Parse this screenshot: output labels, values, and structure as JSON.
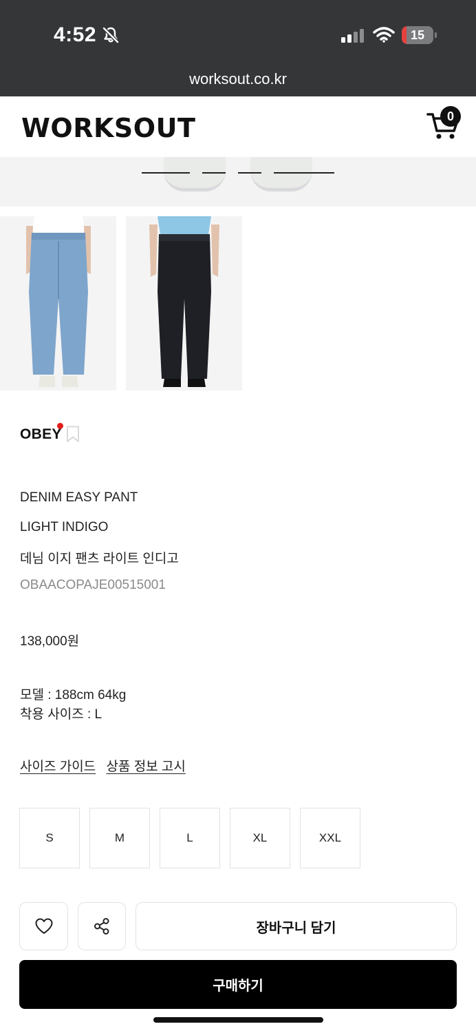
{
  "status_bar": {
    "time": "4:52",
    "battery": "15",
    "battery_level": 0.15,
    "icons": [
      "bell-slash-icon",
      "signal-icon",
      "wifi-icon",
      "battery-icon"
    ]
  },
  "browser": {
    "url": "worksout.co.kr"
  },
  "header": {
    "logo": "WORKSOUT",
    "cart_count": "0",
    "cart_icon": "cart-icon"
  },
  "product": {
    "brand": "OBEY",
    "name_line1": "DENIM EASY PANT",
    "name_line2": "LIGHT INDIGO",
    "name_korean": "데님 이지 팬츠 라이트 인디고",
    "sku": "OBAACOPAJE00515001",
    "price": "138,000원",
    "model_info": "모델 : 188cm  64kg",
    "fit_size": "착용 사이즈 : L"
  },
  "links": {
    "size_guide": "사이즈 가이드",
    "product_notice": "상품 정보 고시"
  },
  "sizes": [
    "S",
    "M",
    "L",
    "XL",
    "XXL"
  ],
  "actions": {
    "add_to_cart": "장바구니 담기",
    "buy_now": "구매하기",
    "wishlist_icon": "heart-icon",
    "share_icon": "share-icon"
  },
  "colors": {
    "status_bg": "#343638",
    "accent_red": "#e21b1b",
    "button_black": "#000000",
    "light_denim": "#7ea5cc",
    "dark_pant": "#1e2026"
  }
}
